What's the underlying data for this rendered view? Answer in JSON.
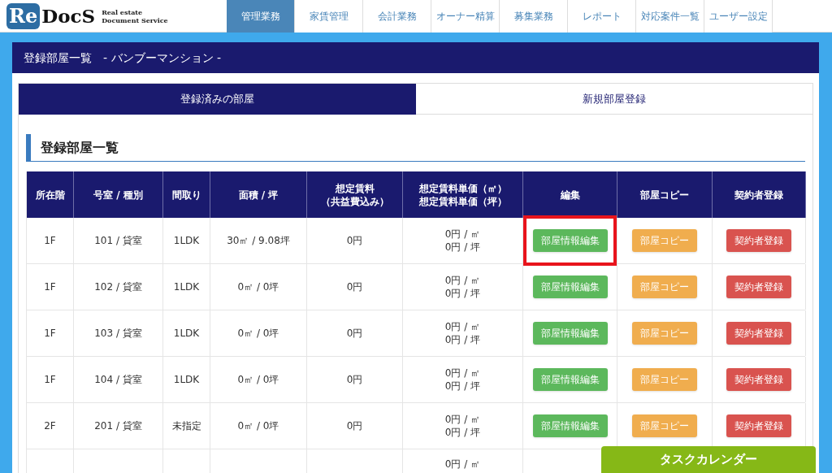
{
  "logo": {
    "mark": "Re",
    "name": "DocS",
    "tagline_1": "Real estate",
    "tagline_2": "Document Service"
  },
  "nav": [
    {
      "label": "管理業務",
      "selected": true
    },
    {
      "label": "家賃管理",
      "selected": false
    },
    {
      "label": "会計業務",
      "selected": false
    },
    {
      "label": "オーナー精算",
      "selected": false
    },
    {
      "label": "募集業務",
      "selected": false
    },
    {
      "label": "レポート",
      "selected": false
    },
    {
      "label": "対応案件一覧",
      "selected": false
    },
    {
      "label": "ユーザー設定",
      "selected": false
    }
  ],
  "page_title": "登録部屋一覧　- バンブーマンション -",
  "tabs": [
    {
      "label": "登録済みの部屋",
      "selected": true
    },
    {
      "label": "新規部屋登録",
      "selected": false
    }
  ],
  "section_title": "登録部屋一覧",
  "table": {
    "columns": [
      {
        "lines": [
          "所在階"
        ]
      },
      {
        "lines": [
          "号室 / 種別"
        ]
      },
      {
        "lines": [
          "間取り"
        ]
      },
      {
        "lines": [
          "面積 / 坪"
        ]
      },
      {
        "lines": [
          "想定賃料",
          "（共益費込み）"
        ]
      },
      {
        "lines": [
          "想定賃料単価（㎡）",
          "想定賃料単価（坪）"
        ]
      },
      {
        "lines": [
          "編集"
        ]
      },
      {
        "lines": [
          "部屋コピー"
        ]
      },
      {
        "lines": [
          "契約者登録"
        ]
      }
    ],
    "rows": [
      {
        "floor": "1F",
        "room": "101 / 貸室",
        "layout": "1LDK",
        "area": "30㎡ / 9.08坪",
        "rent": "0円",
        "unit_m2": "0円 / ㎡",
        "unit_tsubo": "0円 / 坪",
        "edit": "部屋情報編集",
        "copy": "部屋コピー",
        "contract": "契約者登録",
        "highlighted": true
      },
      {
        "floor": "1F",
        "room": "102 / 貸室",
        "layout": "1LDK",
        "area": "0㎡ / 0坪",
        "rent": "0円",
        "unit_m2": "0円 / ㎡",
        "unit_tsubo": "0円 / 坪",
        "edit": "部屋情報編集",
        "copy": "部屋コピー",
        "contract": "契約者登録",
        "highlighted": false
      },
      {
        "floor": "1F",
        "room": "103 / 貸室",
        "layout": "1LDK",
        "area": "0㎡ / 0坪",
        "rent": "0円",
        "unit_m2": "0円 / ㎡",
        "unit_tsubo": "0円 / 坪",
        "edit": "部屋情報編集",
        "copy": "部屋コピー",
        "contract": "契約者登録",
        "highlighted": false
      },
      {
        "floor": "1F",
        "room": "104 / 貸室",
        "layout": "1LDK",
        "area": "0㎡ / 0坪",
        "rent": "0円",
        "unit_m2": "0円 / ㎡",
        "unit_tsubo": "0円 / 坪",
        "edit": "部屋情報編集",
        "copy": "部屋コピー",
        "contract": "契約者登録",
        "highlighted": false
      },
      {
        "floor": "2F",
        "room": "201 / 貸室",
        "layout": "未指定",
        "area": "0㎡ / 0坪",
        "rent": "0円",
        "unit_m2": "0円 / ㎡",
        "unit_tsubo": "0円 / 坪",
        "edit": "部屋情報編集",
        "copy": "部屋コピー",
        "contract": "契約者登録",
        "highlighted": false
      },
      {
        "unit_m2": "0円 / ㎡",
        "highlighted": false
      }
    ]
  },
  "task_calendar": "タスクカレンダー"
}
